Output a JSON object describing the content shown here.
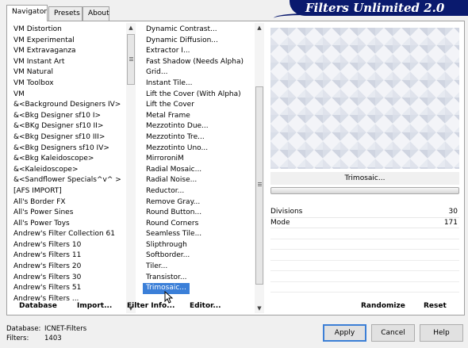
{
  "tabs": [
    "Navigator",
    "Presets",
    "About"
  ],
  "banner_title": "Filters Unlimited 2.0",
  "categories": [
    "VM Distortion",
    "VM Experimental",
    "VM Extravaganza",
    "VM Instant Art",
    "VM Natural",
    "VM Toolbox",
    "VM",
    "&<Background Designers IV>",
    "&<Bkg Designer sf10 I>",
    "&<BKg Designer sf10 II>",
    "&<Bkg Designer sf10 III>",
    "&<Bkg Designers sf10 IV>",
    "&<Bkg Kaleidoscope>",
    "&<Kaleidoscope>",
    "&<Sandflower Specials^v^ >",
    "[AFS IMPORT]",
    "All's Border FX",
    "All's Power Sines",
    "All's Power Toys",
    "Andrew's Filter Collection 61",
    "Andrew's Filters 10",
    "Andrew's Filters 11",
    "Andrew's Filters 20",
    "Andrew's Filters 30",
    "Andrew's Filters 51",
    "Andrew's Filters ..."
  ],
  "filters": [
    "Dynamic Contrast...",
    "Dynamic Diffusion...",
    "Extractor I...",
    "Fast Shadow (Needs Alpha)",
    "Grid...",
    "Instant Tile...",
    "Lift the Cover (With Alpha)",
    "Lift the Cover",
    "Metal Frame",
    "Mezzotinto Due...",
    "Mezzotinto Tre...",
    "Mezzotinto Uno...",
    "MirroroniM",
    "Radial Mosaic...",
    "Radial Noise...",
    "Reductor...",
    "Remove Gray...",
    "Round Button...",
    "Round Corners",
    "Seamless Tile...",
    "Slipthrough",
    "Softborder...",
    "Tiler...",
    "Transistor...",
    "Trimosaic..."
  ],
  "selected_filter": "Trimosaic...",
  "filter_name_display": "Trimosaic...",
  "params": [
    {
      "name": "Divisions",
      "value": "30"
    },
    {
      "name": "Mode",
      "value": "171"
    }
  ],
  "panel_buttons": {
    "database": "Database",
    "import": "Import...",
    "filter_info": "Filter Info...",
    "editor": "Editor...",
    "randomize": "Randomize",
    "reset": "Reset"
  },
  "footer": {
    "database_label": "Database:",
    "database_value": "ICNET-Filters",
    "filters_label": "Filters:",
    "filters_value": "1403"
  },
  "dialog_buttons": {
    "apply": "Apply",
    "cancel": "Cancel",
    "help": "Help"
  },
  "colors": {
    "banner": "#0a1a6e",
    "selection": "#3b7fd8"
  }
}
